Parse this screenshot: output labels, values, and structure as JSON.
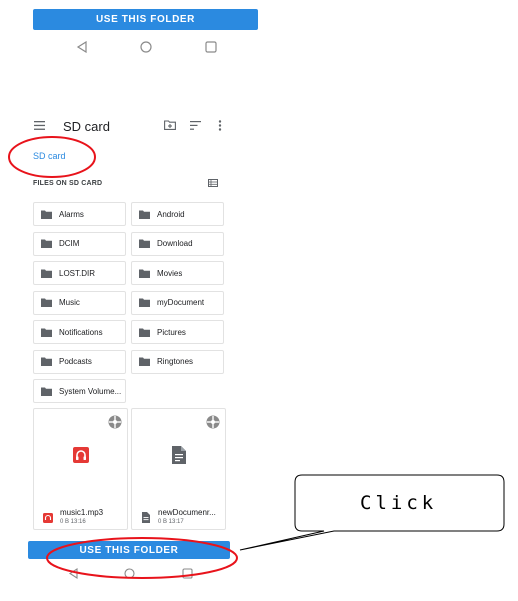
{
  "top_panel": {
    "use_folder_label": "USE THIS FOLDER"
  },
  "toolbar": {
    "title": "SD card"
  },
  "breadcrumb": "SD card",
  "section_header": "FILES ON SD CARD",
  "folders": [
    {
      "name": "Alarms"
    },
    {
      "name": "Android"
    },
    {
      "name": "DCIM"
    },
    {
      "name": "Download"
    },
    {
      "name": "LOST.DIR"
    },
    {
      "name": "Movies"
    },
    {
      "name": "Music"
    },
    {
      "name": "myDocument"
    },
    {
      "name": "Notifications"
    },
    {
      "name": "Pictures"
    },
    {
      "name": "Podcasts"
    },
    {
      "name": "Ringtones"
    },
    {
      "name": "System Volume..."
    }
  ],
  "files": [
    {
      "name": "music1.mp3",
      "meta": "0 B 13:16",
      "type": "audio"
    },
    {
      "name": "newDocumenr...",
      "meta": "0 B 13:17",
      "type": "document"
    }
  ],
  "bottom_panel": {
    "use_folder_label": "USE THIS FOLDER"
  },
  "callout": {
    "text": "Click"
  },
  "colors": {
    "accent": "#2b8ae0",
    "highlight": "#e8131b",
    "audio_icon": "#e53935"
  }
}
